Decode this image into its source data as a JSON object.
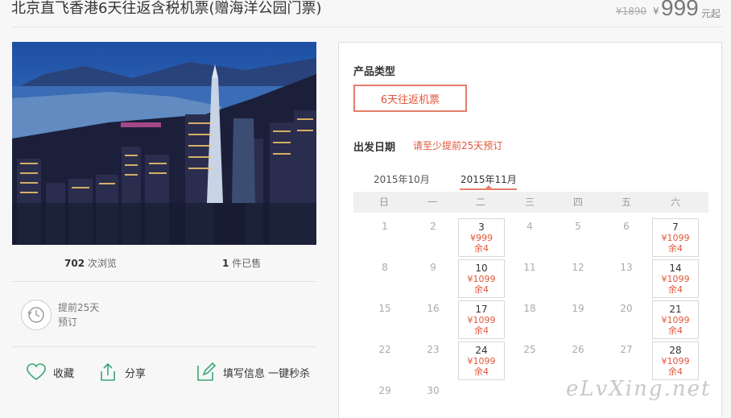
{
  "product": {
    "title": "北京直飞香港6天往返含税机票(赠海洋公园门票)",
    "price_original": "¥1890",
    "price_symbol": "¥",
    "price_current": "999",
    "price_unit": "元起"
  },
  "stats": {
    "views_count": "702",
    "views_label": "次浏览",
    "sold_count": "1",
    "sold_label": "件已售"
  },
  "advance": {
    "line1": "提前25天",
    "line2": "预订"
  },
  "actions": {
    "favorite": "收藏",
    "share": "分享",
    "fill_info": "填写信息 一键秒杀"
  },
  "panel": {
    "product_type_label": "产品类型",
    "product_type_option": "6天往返机票",
    "departure_label": "出发日期",
    "departure_hint": "请至少提前25天预订",
    "months": [
      "2015年10月",
      "2015年11月"
    ],
    "active_month_index": 1,
    "weekdays": [
      "日",
      "一",
      "二",
      "三",
      "四",
      "五",
      "六"
    ],
    "days": [
      {
        "d": "1",
        "col": 0,
        "row": 0
      },
      {
        "d": "2",
        "col": 1,
        "row": 0
      },
      {
        "d": "3",
        "col": 2,
        "row": 0,
        "price": "¥999",
        "remain": "余4"
      },
      {
        "d": "4",
        "col": 3,
        "row": 0
      },
      {
        "d": "5",
        "col": 4,
        "row": 0
      },
      {
        "d": "6",
        "col": 5,
        "row": 0
      },
      {
        "d": "7",
        "col": 6,
        "row": 0,
        "price": "¥1099",
        "remain": "余4"
      },
      {
        "d": "8",
        "col": 0,
        "row": 1
      },
      {
        "d": "9",
        "col": 1,
        "row": 1
      },
      {
        "d": "10",
        "col": 2,
        "row": 1,
        "price": "¥1099",
        "remain": "余4"
      },
      {
        "d": "11",
        "col": 3,
        "row": 1
      },
      {
        "d": "12",
        "col": 4,
        "row": 1
      },
      {
        "d": "13",
        "col": 5,
        "row": 1
      },
      {
        "d": "14",
        "col": 6,
        "row": 1,
        "price": "¥1099",
        "remain": "余4"
      },
      {
        "d": "15",
        "col": 0,
        "row": 2
      },
      {
        "d": "16",
        "col": 1,
        "row": 2
      },
      {
        "d": "17",
        "col": 2,
        "row": 2,
        "price": "¥1099",
        "remain": "余4"
      },
      {
        "d": "18",
        "col": 3,
        "row": 2
      },
      {
        "d": "19",
        "col": 4,
        "row": 2
      },
      {
        "d": "20",
        "col": 5,
        "row": 2
      },
      {
        "d": "21",
        "col": 6,
        "row": 2,
        "price": "¥1099",
        "remain": "余4"
      },
      {
        "d": "22",
        "col": 0,
        "row": 3
      },
      {
        "d": "23",
        "col": 1,
        "row": 3
      },
      {
        "d": "24",
        "col": 2,
        "row": 3,
        "price": "¥1099",
        "remain": "余4"
      },
      {
        "d": "25",
        "col": 3,
        "row": 3
      },
      {
        "d": "26",
        "col": 4,
        "row": 3
      },
      {
        "d": "27",
        "col": 5,
        "row": 3
      },
      {
        "d": "28",
        "col": 6,
        "row": 3,
        "price": "¥1099",
        "remain": "余4"
      },
      {
        "d": "29",
        "col": 0,
        "row": 4
      },
      {
        "d": "30",
        "col": 1,
        "row": 4
      }
    ]
  },
  "watermark": "eLvXing.net",
  "icons": {
    "favorite": "heart-icon",
    "share": "share-icon",
    "fill_info": "edit-icon",
    "advance": "clock-icon"
  },
  "colors": {
    "accent": "#e0573c",
    "accent_border": "#e57e68",
    "icon_green": "#3aa675"
  }
}
